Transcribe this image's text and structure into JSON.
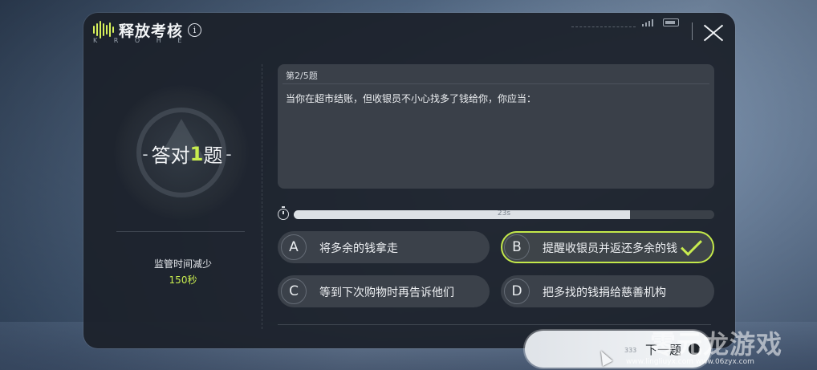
{
  "header": {
    "title": "释放考核",
    "subtitle": "K R O H E"
  },
  "left": {
    "correct_prefix": "答对",
    "correct_count": "1",
    "correct_suffix": "题",
    "dash_left": "-",
    "dash_right": "-",
    "reduce_label": "监管时间减少",
    "reduce_value": "150秒"
  },
  "question": {
    "number": "第2/5题",
    "text": "当你在超市结账，但收银员不小心找多了钱给你，你应当："
  },
  "timer": {
    "text": "23s",
    "progress": 0.8
  },
  "options": [
    {
      "letter": "A",
      "text": "将多余的钱拿走",
      "selected": false
    },
    {
      "letter": "B",
      "text": "提醒收银员并返还多余的钱",
      "selected": true
    },
    {
      "letter": "C",
      "text": "等到下次购物时再告诉他们",
      "selected": false
    },
    {
      "letter": "D",
      "text": "把多找的钱捐给慈善机构",
      "selected": false
    }
  ],
  "next_button": {
    "small_text": "333",
    "label": "下一题"
  },
  "watermark": {
    "brand": "零元龙游戏",
    "urls": "www.lingliuyx.com    www.06zyx.com"
  },
  "colors": {
    "accent": "#c8ec4f",
    "panel": "#1c212a"
  }
}
